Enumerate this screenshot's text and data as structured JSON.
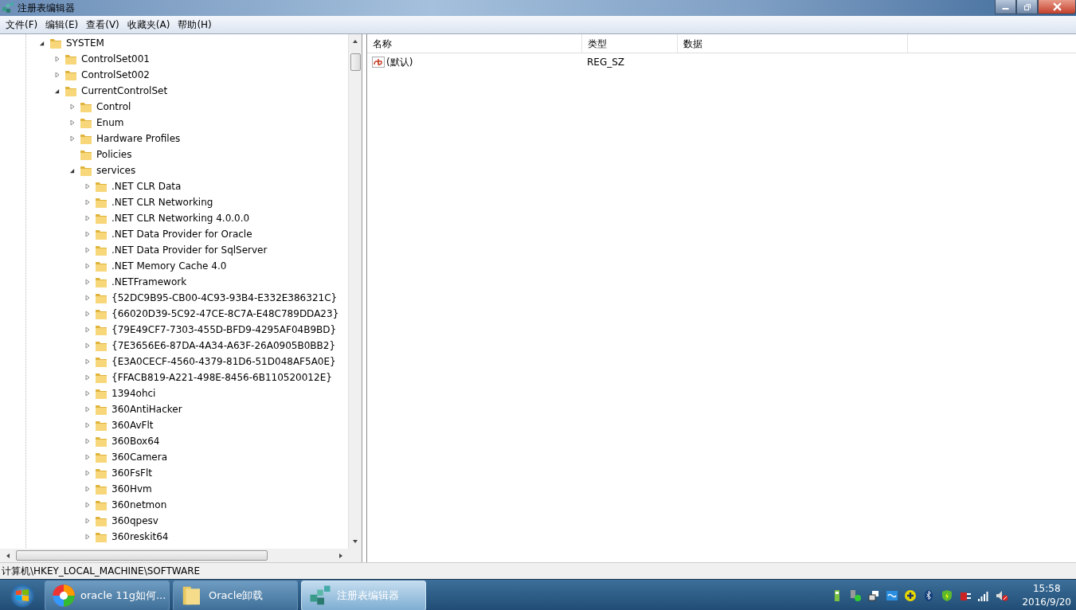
{
  "window": {
    "title": "注册表编辑器"
  },
  "menu": [
    "文件(F)",
    "编辑(E)",
    "查看(V)",
    "收藏夹(A)",
    "帮助(H)"
  ],
  "tree": [
    {
      "label": "SYSTEM",
      "kind": "branch",
      "expanded": true,
      "children": [
        {
          "label": "ControlSet001",
          "kind": "branch",
          "expanded": false
        },
        {
          "label": "ControlSet002",
          "kind": "branch",
          "expanded": false
        },
        {
          "label": "CurrentControlSet",
          "kind": "branch",
          "expanded": true,
          "children": [
            {
              "label": "Control",
              "kind": "branch",
              "expanded": false
            },
            {
              "label": "Enum",
              "kind": "branch",
              "expanded": false
            },
            {
              "label": "Hardware Profiles",
              "kind": "branch",
              "expanded": false
            },
            {
              "label": "Policies",
              "kind": "leaf"
            },
            {
              "label": "services",
              "kind": "branch",
              "expanded": true,
              "children": [
                {
                  "label": ".NET CLR Data",
                  "kind": "branch",
                  "expanded": false
                },
                {
                  "label": ".NET CLR Networking",
                  "kind": "branch",
                  "expanded": false
                },
                {
                  "label": ".NET CLR Networking 4.0.0.0",
                  "kind": "branch",
                  "expanded": false
                },
                {
                  "label": ".NET Data Provider for Oracle",
                  "kind": "branch",
                  "expanded": false
                },
                {
                  "label": ".NET Data Provider for SqlServer",
                  "kind": "branch",
                  "expanded": false
                },
                {
                  "label": ".NET Memory Cache 4.0",
                  "kind": "branch",
                  "expanded": false
                },
                {
                  "label": ".NETFramework",
                  "kind": "branch",
                  "expanded": false
                },
                {
                  "label": "{52DC9B95-CB00-4C93-93B4-E332E386321C}",
                  "kind": "branch",
                  "expanded": false
                },
                {
                  "label": "{66020D39-5C92-47CE-8C7A-E48C789DDA23}",
                  "kind": "branch",
                  "expanded": false
                },
                {
                  "label": "{79E49CF7-7303-455D-BFD9-4295AF04B9BD}",
                  "kind": "branch",
                  "expanded": false
                },
                {
                  "label": "{7E3656E6-87DA-4A34-A63F-26A0905B0BB2}",
                  "kind": "branch",
                  "expanded": false
                },
                {
                  "label": "{E3A0CECF-4560-4379-81D6-51D048AF5A0E}",
                  "kind": "branch",
                  "expanded": false
                },
                {
                  "label": "{FFACB819-A221-498E-8456-6B110520012E}",
                  "kind": "branch",
                  "expanded": false
                },
                {
                  "label": "1394ohci",
                  "kind": "branch",
                  "expanded": false
                },
                {
                  "label": "360AntiHacker",
                  "kind": "branch",
                  "expanded": false
                },
                {
                  "label": "360AvFlt",
                  "kind": "branch",
                  "expanded": false
                },
                {
                  "label": "360Box64",
                  "kind": "branch",
                  "expanded": false
                },
                {
                  "label": "360Camera",
                  "kind": "branch",
                  "expanded": false
                },
                {
                  "label": "360FsFlt",
                  "kind": "branch",
                  "expanded": false
                },
                {
                  "label": "360Hvm",
                  "kind": "branch",
                  "expanded": false
                },
                {
                  "label": "360netmon",
                  "kind": "branch",
                  "expanded": false
                },
                {
                  "label": "360qpesv",
                  "kind": "branch",
                  "expanded": false
                },
                {
                  "label": "360reskit64",
                  "kind": "branch",
                  "expanded": false
                }
              ]
            }
          ]
        }
      ]
    }
  ],
  "table": {
    "columns": [
      "名称",
      "类型",
      "数据"
    ],
    "rows": [
      {
        "name": "(默认)",
        "type": "REG_SZ"
      }
    ]
  },
  "status_bar": "计算机\\HKEY_LOCAL_MACHINE\\SOFTWARE",
  "taskbar": {
    "tasks": [
      {
        "label": "oracle 11g如何...",
        "kind": "browser",
        "selected": false
      },
      {
        "label": "Oracle卸载",
        "kind": "folder",
        "selected": false
      },
      {
        "label": "注册表编辑器",
        "kind": "regedit",
        "selected": true
      }
    ],
    "clock": {
      "time": "15:58",
      "date": "2016/9/20"
    }
  }
}
